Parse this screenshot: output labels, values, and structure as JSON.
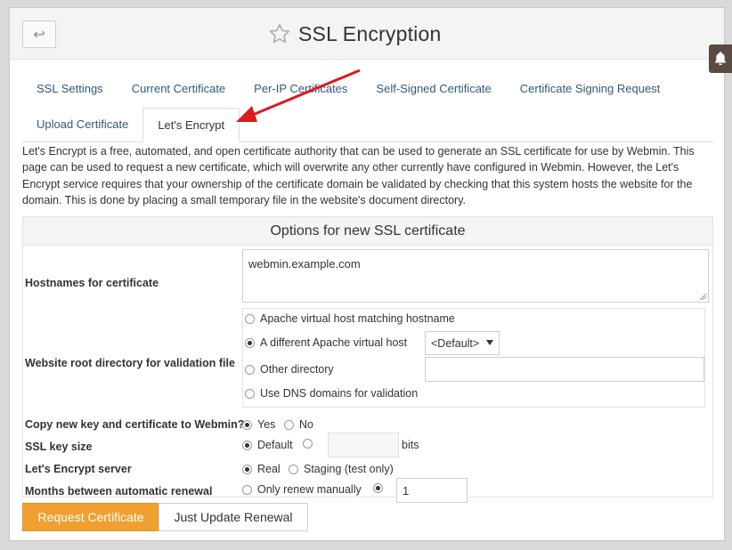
{
  "header": {
    "title": "SSL Encryption"
  },
  "tabs": {
    "row1": [
      "SSL Settings",
      "Current Certificate",
      "Per-IP Certificates",
      "Self-Signed Certificate",
      "Certificate Signing Request"
    ],
    "row2": [
      "Upload Certificate",
      "Let's Encrypt"
    ],
    "active": "Let's Encrypt"
  },
  "description": "Let's Encrypt is a free, automated, and open certificate authority that can be used to generate an SSL certificate for use by Webmin. This page can be used to request a new certificate, which will overwrite any other currently have configured in Webmin. However, the Let's Encrypt service requires that your ownership of the certificate domain be validated by checking that this system hosts the website for the domain. This is done by placing a small temporary file in the website's document directory.",
  "options": {
    "section_title": "Options for new SSL certificate",
    "hostnames": {
      "label": "Hostnames for certificate",
      "value": "webmin.example.com"
    },
    "webroot": {
      "label": "Website root directory for validation file",
      "opt_apache_match": "Apache virtual host matching hostname",
      "opt_apache_other": "A different Apache virtual host",
      "vhost_select": "<Default>",
      "opt_other_dir": "Other directory",
      "other_dir_value": "",
      "opt_dns": "Use DNS domains for validation",
      "selected": "A different Apache virtual host"
    },
    "copy_key": {
      "label": "Copy new key and certificate to Webmin?",
      "yes": "Yes",
      "no": "No",
      "selected": "Yes"
    },
    "key_size": {
      "label": "SSL key size",
      "default": "Default",
      "value": "",
      "unit": "bits",
      "selected": "Default"
    },
    "server": {
      "label": "Let's Encrypt server",
      "real": "Real",
      "staging": "Staging (test only)",
      "selected": "Real"
    },
    "renewal": {
      "label": "Months between automatic renewal",
      "manual": "Only renew manually",
      "value": "1",
      "selected": "months"
    }
  },
  "buttons": {
    "request": "Request Certificate",
    "update": "Just Update Renewal"
  },
  "colors": {
    "accent": "#f0a030",
    "link": "#31587a",
    "annotation_arrow": "#e0191e"
  }
}
